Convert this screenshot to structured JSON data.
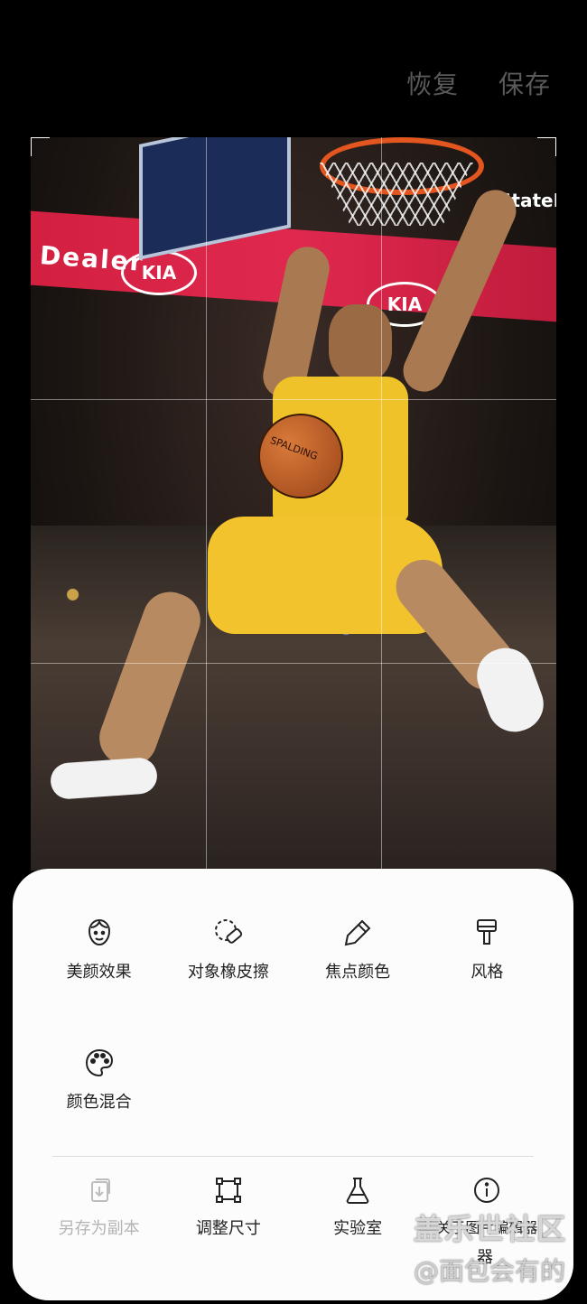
{
  "top_actions": {
    "undo": "恢复",
    "save": "保存"
  },
  "photo": {
    "banner_texts": [
      "Dealer",
      "KIA",
      "KIA",
      "StateFa"
    ],
    "ball_text": "SPALDING"
  },
  "menu": {
    "items": [
      {
        "label": "美颜效果",
        "icon": "face-icon"
      },
      {
        "label": "对象橡皮擦",
        "icon": "eraser-icon"
      },
      {
        "label": "焦点颜色",
        "icon": "dropper-icon"
      },
      {
        "label": "风格",
        "icon": "brush-icon"
      },
      {
        "label": "颜色混合",
        "icon": "palette-icon"
      }
    ]
  },
  "bottom": {
    "items": [
      {
        "label": "另存为副本",
        "icon": "copy-icon",
        "enabled": false
      },
      {
        "label": "调整尺寸",
        "icon": "resize-icon",
        "enabled": true
      },
      {
        "label": "实验室",
        "icon": "flask-icon",
        "enabled": true
      },
      {
        "label": "关于图片编辑器",
        "icon": "info-icon",
        "enabled": true
      }
    ]
  },
  "watermark": {
    "line1": "盖乐世社区",
    "line2": "@面包会有的"
  },
  "extra_char": "器"
}
